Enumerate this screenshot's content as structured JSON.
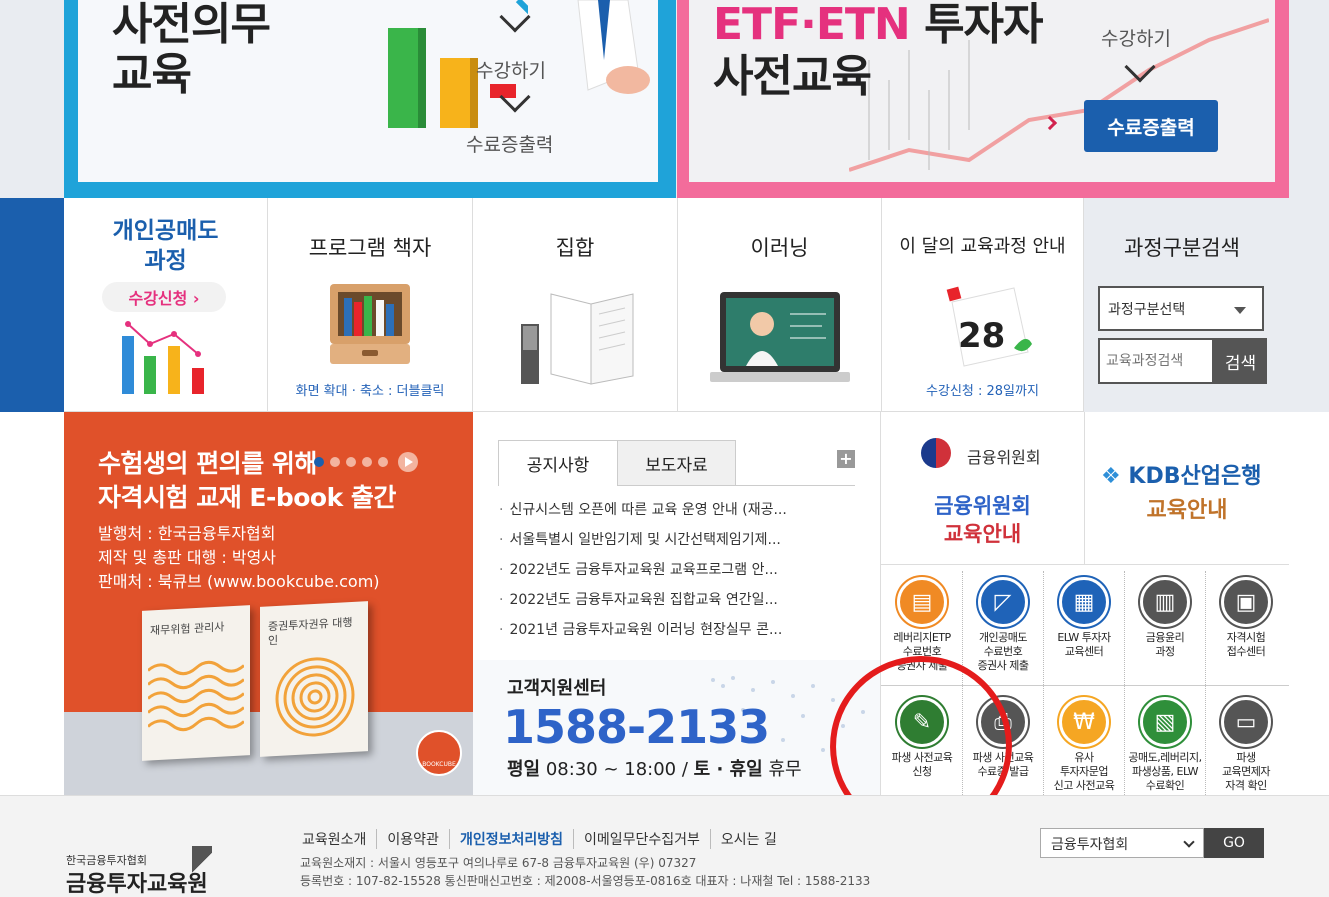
{
  "banners": {
    "left": {
      "title_line1": "사전의무",
      "title_line2": "교육",
      "enroll_label": "수강하기",
      "certificate_label": "수료증출력"
    },
    "right": {
      "title_line1_a": "ETF·ETN",
      "title_line1_b": "투자자",
      "title_line2": "사전교육",
      "enroll_label": "수강하기",
      "certificate_label": "수료증출력"
    }
  },
  "menu": {
    "short_selling": {
      "title_line1": "개인공매도",
      "title_line2": "과정",
      "button": "수강신청 ›"
    },
    "program_book": {
      "title": "프로그램 책자",
      "sub": "화면 확대 · 축소 : 더블클릭"
    },
    "classroom": {
      "title": "집합"
    },
    "elearning": {
      "title": "이러닝"
    },
    "monthly": {
      "title": "이 달의 교육과정 안내",
      "day": "28",
      "sub": "수강신청 : 28일까지"
    },
    "search": {
      "title": "과정구분검색",
      "select_value": "과정구분선택",
      "input_placeholder": "교육과정검색",
      "button": "검색"
    }
  },
  "ebook": {
    "title_line1": "수험생의 편의를 위해",
    "title_line2": "자격시험 교재 E-book 출간",
    "info": [
      "발행처 : 한국금융투자협회",
      "제작 및 총판 대행 : 박영사",
      "판매처 : 북큐브 (www.bookcube.com)"
    ],
    "book1_title": "재무위험 관리사",
    "book2_title": "증권투자권유 대행인",
    "publisher_badge": "BOOKCUBE"
  },
  "notice": {
    "tabs": [
      "공지사항",
      "보도자료"
    ],
    "plus": "+",
    "items": [
      "신규시스템 오픈에 따른 교육 운영 안내 (재공...",
      "서울특별시 일반임기제 및 시간선택제임기제...",
      "2022년도 금융투자교육원 교육프로그램 안...",
      "2022년도 금융투자교육원 집합교육 연간일...",
      "2021년 금융투자교육원 이러닝 현장실무 콘..."
    ]
  },
  "support": {
    "title": "고객지원센터",
    "phone": "1588-2133",
    "hours_a": "평일",
    "hours_b": "08:30 ~ 18:00 /",
    "hours_c": "토 · 휴일",
    "hours_d": "휴무"
  },
  "partners": {
    "fsc_logo": "금융위원회",
    "fsc_line1": "금융위원회",
    "fsc_line2": "교육안내",
    "kdb_logo": "KDB산업은행",
    "kdb_line2": "교육안내"
  },
  "quick_links": [
    {
      "line1": "레버리지ETP",
      "line2": "수료번호",
      "line3": "증권사 제출",
      "color": "#f08a24",
      "icon": "certificate-icon"
    },
    {
      "line1": "개인공매도",
      "line2": "수료번호",
      "line3": "증권사 제출",
      "color": "#1f63b8",
      "icon": "chart-icon"
    },
    {
      "line1": "ELW 투자자",
      "line2": "교육센터",
      "line3": "",
      "color": "#1f63b8",
      "icon": "card-icon"
    },
    {
      "line1": "금융윤리",
      "line2": "과정",
      "line3": "",
      "color": "#555555",
      "icon": "money-icon"
    },
    {
      "line1": "자격시험",
      "line2": "접수센터",
      "line3": "",
      "color": "#555555",
      "icon": "badge-icon"
    },
    {
      "line1": "파생 사전교육",
      "line2": "신청",
      "line3": "",
      "color": "#2f7d32",
      "icon": "pencil-icon"
    },
    {
      "line1": "파생 사전교육",
      "line2": "수료증 발급",
      "line3": "",
      "color": "#555555",
      "icon": "printer-icon"
    },
    {
      "line1": "유사",
      "line2": "투자자문업",
      "line3": "신고 사전교육",
      "color": "#f5a623",
      "icon": "won-icon"
    },
    {
      "line1": "공매도,레버리지,",
      "line2": "파생상품, ELW",
      "line3": "수료확인",
      "color": "#2f8f3a",
      "icon": "diploma-icon"
    },
    {
      "line1": "파생",
      "line2": "교육면제자",
      "line3": "자격 확인",
      "color": "#555555",
      "icon": "id-card-icon"
    }
  ],
  "footer": {
    "logo_small": "한국금융투자협회",
    "logo_big": "금융투자교육원",
    "links": [
      "교육원소개",
      "이용약관",
      "개인정보처리방침",
      "이메일무단수집거부",
      "오시는 길"
    ],
    "address": "교육원소재지 : 서울시 영등포구 여의나루로 67-8 금융투자교육원 (우) 07327",
    "registration": "등록번호 : 107-82-15528 통신판매신고번호 : 제2008-서울영등포-0816호 대표자 : 나재철 Tel : 1588-2133",
    "family_select": "금융투자협회",
    "go_button": "GO"
  },
  "colors": {
    "brand_blue": "#1b5fad",
    "left_banner_border": "#1fa3d9",
    "right_banner_border": "#f36c9b",
    "ebook_bg": "#e0512a",
    "annotation_red": "#e41c1c"
  }
}
